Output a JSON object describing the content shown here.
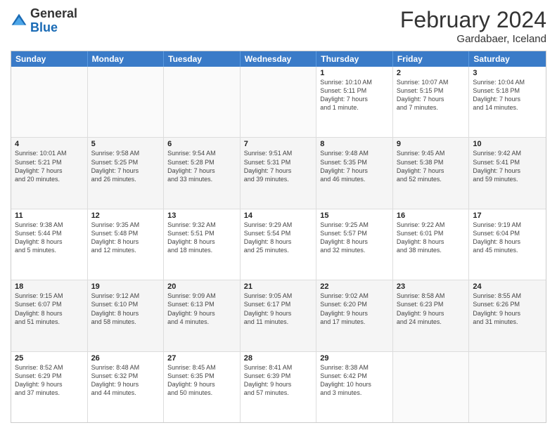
{
  "header": {
    "logo_general": "General",
    "logo_blue": "Blue",
    "month_title": "February 2024",
    "location": "Gardabaer, Iceland"
  },
  "days_of_week": [
    "Sunday",
    "Monday",
    "Tuesday",
    "Wednesday",
    "Thursday",
    "Friday",
    "Saturday"
  ],
  "rows": [
    [
      {
        "day": "",
        "text": ""
      },
      {
        "day": "",
        "text": ""
      },
      {
        "day": "",
        "text": ""
      },
      {
        "day": "",
        "text": ""
      },
      {
        "day": "1",
        "text": "Sunrise: 10:10 AM\nSunset: 5:11 PM\nDaylight: 7 hours\nand 1 minute."
      },
      {
        "day": "2",
        "text": "Sunrise: 10:07 AM\nSunset: 5:15 PM\nDaylight: 7 hours\nand 7 minutes."
      },
      {
        "day": "3",
        "text": "Sunrise: 10:04 AM\nSunset: 5:18 PM\nDaylight: 7 hours\nand 14 minutes."
      }
    ],
    [
      {
        "day": "4",
        "text": "Sunrise: 10:01 AM\nSunset: 5:21 PM\nDaylight: 7 hours\nand 20 minutes."
      },
      {
        "day": "5",
        "text": "Sunrise: 9:58 AM\nSunset: 5:25 PM\nDaylight: 7 hours\nand 26 minutes."
      },
      {
        "day": "6",
        "text": "Sunrise: 9:54 AM\nSunset: 5:28 PM\nDaylight: 7 hours\nand 33 minutes."
      },
      {
        "day": "7",
        "text": "Sunrise: 9:51 AM\nSunset: 5:31 PM\nDaylight: 7 hours\nand 39 minutes."
      },
      {
        "day": "8",
        "text": "Sunrise: 9:48 AM\nSunset: 5:35 PM\nDaylight: 7 hours\nand 46 minutes."
      },
      {
        "day": "9",
        "text": "Sunrise: 9:45 AM\nSunset: 5:38 PM\nDaylight: 7 hours\nand 52 minutes."
      },
      {
        "day": "10",
        "text": "Sunrise: 9:42 AM\nSunset: 5:41 PM\nDaylight: 7 hours\nand 59 minutes."
      }
    ],
    [
      {
        "day": "11",
        "text": "Sunrise: 9:38 AM\nSunset: 5:44 PM\nDaylight: 8 hours\nand 5 minutes."
      },
      {
        "day": "12",
        "text": "Sunrise: 9:35 AM\nSunset: 5:48 PM\nDaylight: 8 hours\nand 12 minutes."
      },
      {
        "day": "13",
        "text": "Sunrise: 9:32 AM\nSunset: 5:51 PM\nDaylight: 8 hours\nand 18 minutes."
      },
      {
        "day": "14",
        "text": "Sunrise: 9:29 AM\nSunset: 5:54 PM\nDaylight: 8 hours\nand 25 minutes."
      },
      {
        "day": "15",
        "text": "Sunrise: 9:25 AM\nSunset: 5:57 PM\nDaylight: 8 hours\nand 32 minutes."
      },
      {
        "day": "16",
        "text": "Sunrise: 9:22 AM\nSunset: 6:01 PM\nDaylight: 8 hours\nand 38 minutes."
      },
      {
        "day": "17",
        "text": "Sunrise: 9:19 AM\nSunset: 6:04 PM\nDaylight: 8 hours\nand 45 minutes."
      }
    ],
    [
      {
        "day": "18",
        "text": "Sunrise: 9:15 AM\nSunset: 6:07 PM\nDaylight: 8 hours\nand 51 minutes."
      },
      {
        "day": "19",
        "text": "Sunrise: 9:12 AM\nSunset: 6:10 PM\nDaylight: 8 hours\nand 58 minutes."
      },
      {
        "day": "20",
        "text": "Sunrise: 9:09 AM\nSunset: 6:13 PM\nDaylight: 9 hours\nand 4 minutes."
      },
      {
        "day": "21",
        "text": "Sunrise: 9:05 AM\nSunset: 6:17 PM\nDaylight: 9 hours\nand 11 minutes."
      },
      {
        "day": "22",
        "text": "Sunrise: 9:02 AM\nSunset: 6:20 PM\nDaylight: 9 hours\nand 17 minutes."
      },
      {
        "day": "23",
        "text": "Sunrise: 8:58 AM\nSunset: 6:23 PM\nDaylight: 9 hours\nand 24 minutes."
      },
      {
        "day": "24",
        "text": "Sunrise: 8:55 AM\nSunset: 6:26 PM\nDaylight: 9 hours\nand 31 minutes."
      }
    ],
    [
      {
        "day": "25",
        "text": "Sunrise: 8:52 AM\nSunset: 6:29 PM\nDaylight: 9 hours\nand 37 minutes."
      },
      {
        "day": "26",
        "text": "Sunrise: 8:48 AM\nSunset: 6:32 PM\nDaylight: 9 hours\nand 44 minutes."
      },
      {
        "day": "27",
        "text": "Sunrise: 8:45 AM\nSunset: 6:35 PM\nDaylight: 9 hours\nand 50 minutes."
      },
      {
        "day": "28",
        "text": "Sunrise: 8:41 AM\nSunset: 6:39 PM\nDaylight: 9 hours\nand 57 minutes."
      },
      {
        "day": "29",
        "text": "Sunrise: 8:38 AM\nSunset: 6:42 PM\nDaylight: 10 hours\nand 3 minutes."
      },
      {
        "day": "",
        "text": ""
      },
      {
        "day": "",
        "text": ""
      }
    ]
  ]
}
